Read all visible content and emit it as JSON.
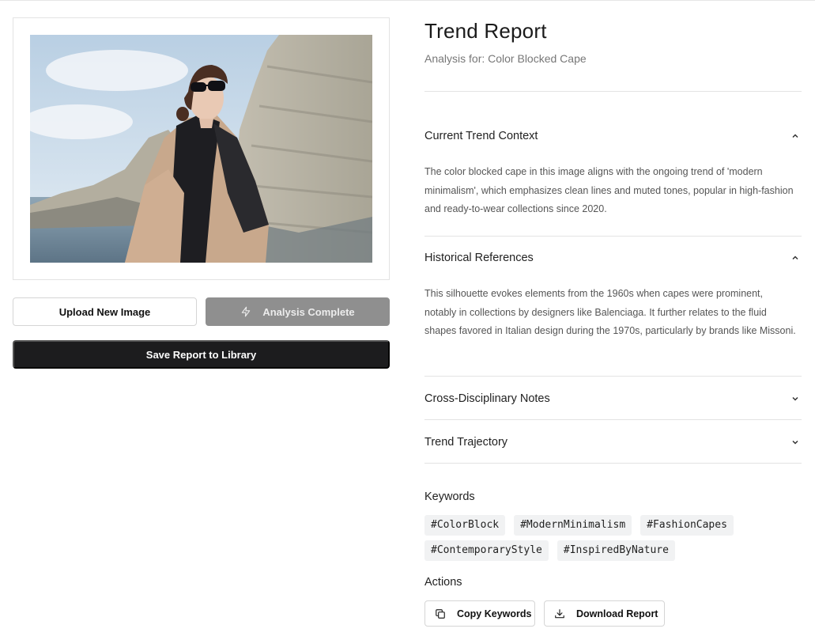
{
  "left": {
    "upload_label": "Upload New Image",
    "analysis_label": "Analysis Complete",
    "save_label": "Save Report to Library"
  },
  "report": {
    "title": "Trend Report",
    "subtitle": "Analysis for: Color Blocked Cape",
    "sections": [
      {
        "title": "Current Trend Context",
        "expanded": true,
        "body": "The color blocked cape in this image aligns with the ongoing trend of 'modern minimalism', which emphasizes clean lines and muted tones, popular in high-fashion and ready-to-wear collections since 2020."
      },
      {
        "title": "Historical References",
        "expanded": true,
        "body": "This silhouette evokes elements from the 1960s when capes were prominent, notably in collections by designers like Balenciaga. It further relates to the fluid shapes favored in Italian design during the 1970s, particularly by brands like Missoni."
      },
      {
        "title": "Cross-Disciplinary Notes",
        "expanded": false
      },
      {
        "title": "Trend Trajectory",
        "expanded": false
      }
    ],
    "keywords_label": "Keywords",
    "keywords": [
      "#ColorBlock",
      "#ModernMinimalism",
      "#FashionCapes",
      "#ContemporaryStyle",
      "#InspiredByNature"
    ],
    "actions_label": "Actions",
    "copy_label": "Copy Keywords",
    "download_label": "Download Report"
  },
  "icons": {
    "analysis": "bolt-icon",
    "expanded": "chevron-up-icon",
    "collapsed": "chevron-down-icon",
    "copy": "copy-icon",
    "download": "download-icon"
  },
  "colors": {
    "primary_dark": "#1c1c1e",
    "disabled_gray": "#8f8f8f",
    "tag_bg": "#f1f2f3"
  }
}
